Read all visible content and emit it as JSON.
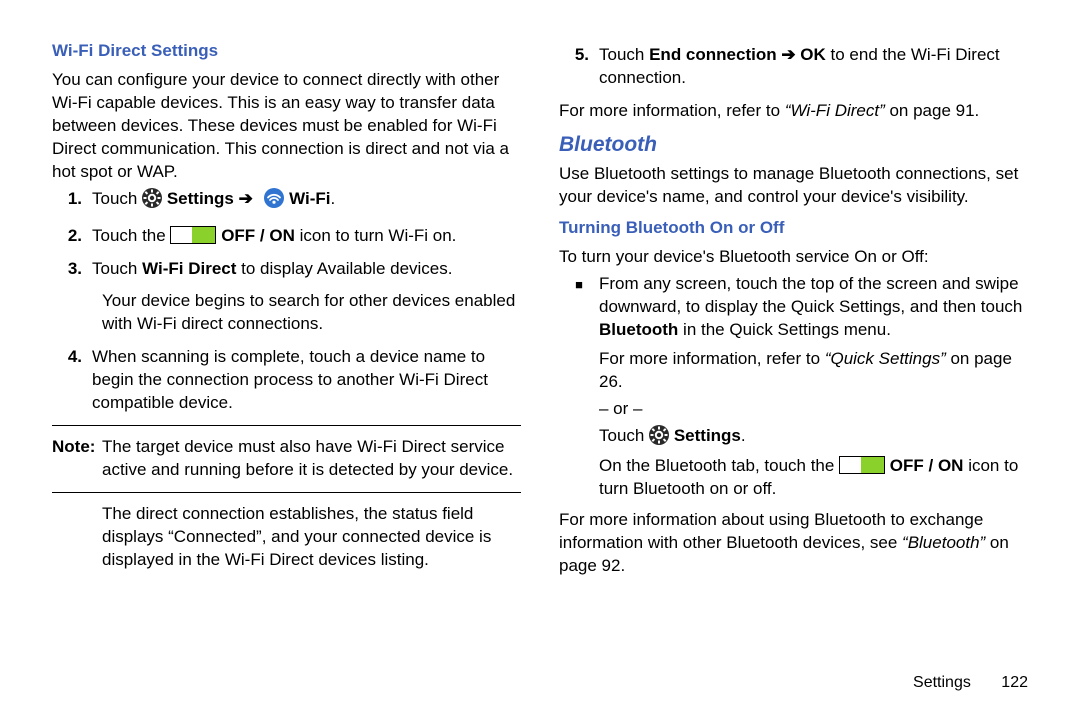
{
  "left": {
    "heading": "Wi-Fi Direct Settings",
    "intro": "You can configure your device to connect directly with other Wi-Fi capable devices. This is an easy way to transfer data between devices. These devices must be enabled for Wi-Fi Direct communication. This connection is direct and not via a hot spot or WAP.",
    "steps": {
      "s1_touch": "Touch ",
      "s1_settings": " Settings ",
      "s1_arrow": "➔",
      "s1_wifi": " Wi-Fi",
      "s1_period": ".",
      "s2_a": "Touch the ",
      "s2_b": " OFF / ON",
      "s2_c": " icon to turn Wi-Fi on.",
      "s3_a": "Touch ",
      "s3_b": "Wi-Fi Direct",
      "s3_c": " to display Available devices.",
      "s3_cont": "Your device begins to search for other devices enabled with Wi-Fi direct connections.",
      "s4": "When scanning is complete, touch a device name to begin the connection process to another Wi-Fi Direct compatible device."
    },
    "note_label": "Note:",
    "note_body": "The target device must also have Wi-Fi Direct service active and running before it is detected by your device.",
    "after_note": "The direct connection establishes, the status field displays “Connected”, and your connected device is displayed in the Wi-Fi Direct devices listing."
  },
  "right": {
    "s5_a": "Touch ",
    "s5_b": "End connection ",
    "s5_arrow": "➔",
    "s5_c": " OK",
    "s5_d": " to end the Wi-Fi Direct connection.",
    "ref1_a": "For more information, refer to ",
    "ref1_b": "“Wi-Fi Direct”",
    "ref1_c": " on page 91.",
    "bt_heading": "Bluetooth",
    "bt_intro": "Use Bluetooth settings to manage Bluetooth connections, set your device's name, and control your device's visibility.",
    "bt_sub": "Turning Bluetooth On or Off",
    "bt_lead": "To turn your device's Bluetooth service On or Off:",
    "bullet1_a": "From any screen, touch the top of the screen and swipe downward, to display the Quick Settings, and then touch ",
    "bullet1_b": "Bluetooth",
    "bullet1_c": " in the Quick Settings menu.",
    "bullet1_ref_a": "For more information, refer to ",
    "bullet1_ref_b": "“Quick Settings”",
    "bullet1_ref_c": " on page 26.",
    "or": "– or –",
    "touch": "Touch ",
    "settings": " Settings",
    "period": ".",
    "tab_a": "On the Bluetooth tab, touch the ",
    "tab_b": " OFF / ON",
    "tab_c": " icon to turn Bluetooth on or off.",
    "ref2_a": "For more information about using Bluetooth to exchange information with other Bluetooth devices, see ",
    "ref2_b": "“Bluetooth”",
    "ref2_c": " on page 92."
  },
  "footer": {
    "section": "Settings",
    "page": "122"
  }
}
